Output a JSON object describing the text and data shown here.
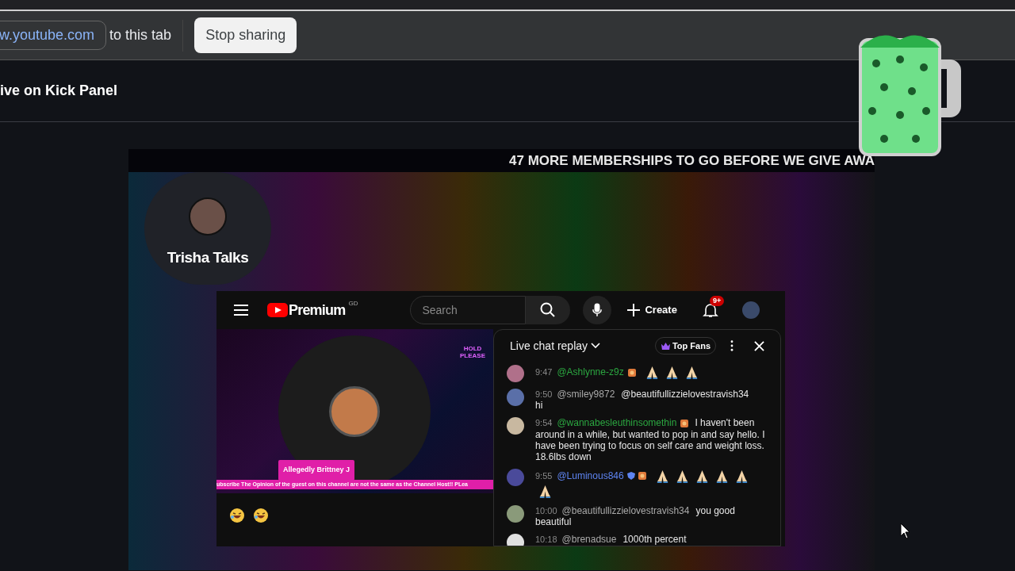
{
  "share_bar": {
    "site": "w.youtube.com",
    "message": "to this tab",
    "button": "Stop sharing"
  },
  "page": {
    "title": "ive on Kick Panel"
  },
  "stream": {
    "banner": "47 MORE MEMBERSHIPS TO GO BEFORE WE GIVE AWA",
    "host": {
      "name": "Trisha Talks"
    }
  },
  "youtube": {
    "logo": "Premium",
    "region": "GD",
    "search": {
      "placeholder": "Search"
    },
    "create": "Create",
    "notifications": "9+",
    "player": {
      "guest": "Allegedly Brittney J",
      "hold": "HOLD PLEASE",
      "ticker": "ubscribe    The Opinion of the guest on this channel are not the same as the Channel Host!! PLea"
    },
    "reactions": [
      {
        "kind": "laugh"
      },
      {
        "kind": "laugh"
      }
    ],
    "chat": {
      "title": "Live chat replay",
      "filter": "Top Fans",
      "messages": [
        {
          "time": "9:47",
          "author": "@Ashlynne-z9z",
          "kind": "member",
          "badges": [
            {
              "kind": "sticker"
            }
          ],
          "parts": [
            {
              "kind": "pray"
            },
            {
              "kind": "pray"
            },
            {
              "kind": "pray"
            }
          ]
        },
        {
          "time": "9:50",
          "author": "@smiley9872",
          "kind": "viewer",
          "parts": [
            {
              "kind": "text",
              "text": "@beautifullizzielovestravish34"
            },
            {
              "kind": "line",
              "text": "hi"
            }
          ]
        },
        {
          "time": "9:54",
          "author": "@wannabesleuthinsomethin",
          "kind": "member",
          "badges": [
            {
              "kind": "sticker"
            }
          ],
          "parts": [
            {
              "kind": "text",
              "text": "I haven't been"
            },
            {
              "kind": "line",
              "text": "around in a while, but wanted to pop in and say hello. I have been trying to focus on self care and weight loss. 18.6lbs down"
            }
          ]
        },
        {
          "time": "9:55",
          "author": "@Luminous846",
          "kind": "moderator",
          "badges": [
            {
              "kind": "shield"
            },
            {
              "kind": "sticker"
            }
          ],
          "parts": [
            {
              "kind": "pray"
            },
            {
              "kind": "pray"
            },
            {
              "kind": "pray"
            },
            {
              "kind": "pray"
            },
            {
              "kind": "pray"
            },
            {
              "kind": "pray"
            }
          ]
        },
        {
          "time": "10:00",
          "author": "@beautifullizzielovestravish34",
          "kind": "viewer",
          "parts": [
            {
              "kind": "text",
              "text": "you good"
            },
            {
              "kind": "line",
              "text": "beautiful"
            }
          ]
        },
        {
          "time": "10:18",
          "author": "@brenadsue",
          "kind": "viewer",
          "parts": [
            {
              "kind": "text",
              "text": "1000th percent"
            }
          ]
        }
      ]
    }
  }
}
